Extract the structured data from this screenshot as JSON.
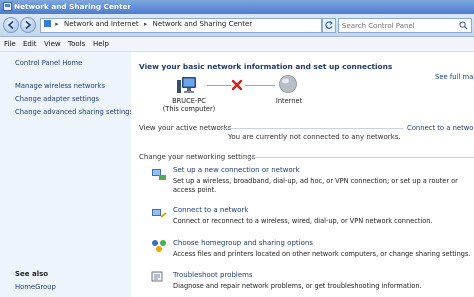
{
  "window": {
    "title": "Network and Sharing Center"
  },
  "address": {
    "crumbs": [
      "Network and Internet",
      "Network and Sharing Center"
    ],
    "separator": "▸",
    "search_placeholder": "Search Control Panel"
  },
  "menu": [
    "File",
    "Edit",
    "View",
    "Tools",
    "Help"
  ],
  "sidebar": {
    "home": "Control Panel Home",
    "items": [
      "Manage wireless networks",
      "Change adapter settings",
      "Change advanced sharing settings"
    ],
    "see_also_title": "See also",
    "see_also_items": [
      "HomeGroup"
    ]
  },
  "main": {
    "heading": "View your basic network information and set up connections",
    "see_full_map": "See full map",
    "computer": {
      "name": "BRUCE-PC",
      "sub": "(This computer)"
    },
    "internet": "Internet",
    "active_label": "View your active networks",
    "connect_link": "Connect to a network",
    "not_connected": "You are currently not connected to any networks.",
    "change_label": "Change your networking settings",
    "tasks": [
      {
        "link": "Set up a new connection or network",
        "desc": "Set up a wireless, broadband, dial-up, ad hoc, or VPN connection; or set up a router or access point."
      },
      {
        "link": "Connect to a network",
        "desc": "Connect or reconnect to a wireless, wired, dial-up, or VPN network connection."
      },
      {
        "link": "Choose homegroup and sharing options",
        "desc": "Access files and printers located on other network computers, or change sharing settings."
      },
      {
        "link": "Troubleshoot problems",
        "desc": "Diagnose and repair network problems, or get troubleshooting information."
      }
    ]
  },
  "colors": {
    "link": "#1e3d78",
    "sidebar_bg": "#eef4fc",
    "titlebar": "#4b7ccf",
    "error_x": "#d42020"
  }
}
